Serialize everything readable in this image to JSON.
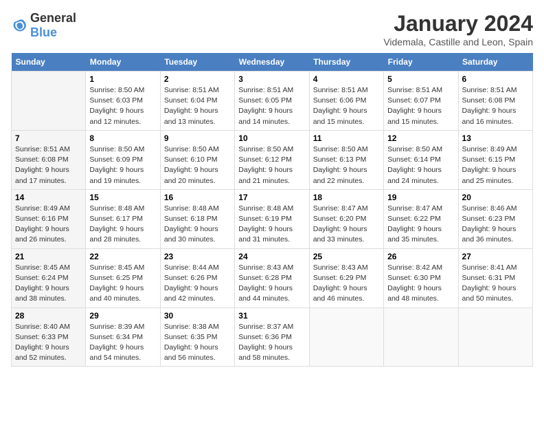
{
  "logo": {
    "general": "General",
    "blue": "Blue"
  },
  "header": {
    "month": "January 2024",
    "location": "Videmala, Castille and Leon, Spain"
  },
  "weekdays": [
    "Sunday",
    "Monday",
    "Tuesday",
    "Wednesday",
    "Thursday",
    "Friday",
    "Saturday"
  ],
  "weeks": [
    [
      {
        "day": "",
        "sunrise": "",
        "sunset": "",
        "daylight": ""
      },
      {
        "day": "1",
        "sunrise": "Sunrise: 8:50 AM",
        "sunset": "Sunset: 6:03 PM",
        "daylight": "Daylight: 9 hours and 12 minutes."
      },
      {
        "day": "2",
        "sunrise": "Sunrise: 8:51 AM",
        "sunset": "Sunset: 6:04 PM",
        "daylight": "Daylight: 9 hours and 13 minutes."
      },
      {
        "day": "3",
        "sunrise": "Sunrise: 8:51 AM",
        "sunset": "Sunset: 6:05 PM",
        "daylight": "Daylight: 9 hours and 14 minutes."
      },
      {
        "day": "4",
        "sunrise": "Sunrise: 8:51 AM",
        "sunset": "Sunset: 6:06 PM",
        "daylight": "Daylight: 9 hours and 15 minutes."
      },
      {
        "day": "5",
        "sunrise": "Sunrise: 8:51 AM",
        "sunset": "Sunset: 6:07 PM",
        "daylight": "Daylight: 9 hours and 15 minutes."
      },
      {
        "day": "6",
        "sunrise": "Sunrise: 8:51 AM",
        "sunset": "Sunset: 6:08 PM",
        "daylight": "Daylight: 9 hours and 16 minutes."
      }
    ],
    [
      {
        "day": "7",
        "sunrise": "Sunrise: 8:51 AM",
        "sunset": "Sunset: 6:08 PM",
        "daylight": "Daylight: 9 hours and 17 minutes."
      },
      {
        "day": "8",
        "sunrise": "Sunrise: 8:50 AM",
        "sunset": "Sunset: 6:09 PM",
        "daylight": "Daylight: 9 hours and 19 minutes."
      },
      {
        "day": "9",
        "sunrise": "Sunrise: 8:50 AM",
        "sunset": "Sunset: 6:10 PM",
        "daylight": "Daylight: 9 hours and 20 minutes."
      },
      {
        "day": "10",
        "sunrise": "Sunrise: 8:50 AM",
        "sunset": "Sunset: 6:12 PM",
        "daylight": "Daylight: 9 hours and 21 minutes."
      },
      {
        "day": "11",
        "sunrise": "Sunrise: 8:50 AM",
        "sunset": "Sunset: 6:13 PM",
        "daylight": "Daylight: 9 hours and 22 minutes."
      },
      {
        "day": "12",
        "sunrise": "Sunrise: 8:50 AM",
        "sunset": "Sunset: 6:14 PM",
        "daylight": "Daylight: 9 hours and 24 minutes."
      },
      {
        "day": "13",
        "sunrise": "Sunrise: 8:49 AM",
        "sunset": "Sunset: 6:15 PM",
        "daylight": "Daylight: 9 hours and 25 minutes."
      }
    ],
    [
      {
        "day": "14",
        "sunrise": "Sunrise: 8:49 AM",
        "sunset": "Sunset: 6:16 PM",
        "daylight": "Daylight: 9 hours and 26 minutes."
      },
      {
        "day": "15",
        "sunrise": "Sunrise: 8:48 AM",
        "sunset": "Sunset: 6:17 PM",
        "daylight": "Daylight: 9 hours and 28 minutes."
      },
      {
        "day": "16",
        "sunrise": "Sunrise: 8:48 AM",
        "sunset": "Sunset: 6:18 PM",
        "daylight": "Daylight: 9 hours and 30 minutes."
      },
      {
        "day": "17",
        "sunrise": "Sunrise: 8:48 AM",
        "sunset": "Sunset: 6:19 PM",
        "daylight": "Daylight: 9 hours and 31 minutes."
      },
      {
        "day": "18",
        "sunrise": "Sunrise: 8:47 AM",
        "sunset": "Sunset: 6:20 PM",
        "daylight": "Daylight: 9 hours and 33 minutes."
      },
      {
        "day": "19",
        "sunrise": "Sunrise: 8:47 AM",
        "sunset": "Sunset: 6:22 PM",
        "daylight": "Daylight: 9 hours and 35 minutes."
      },
      {
        "day": "20",
        "sunrise": "Sunrise: 8:46 AM",
        "sunset": "Sunset: 6:23 PM",
        "daylight": "Daylight: 9 hours and 36 minutes."
      }
    ],
    [
      {
        "day": "21",
        "sunrise": "Sunrise: 8:45 AM",
        "sunset": "Sunset: 6:24 PM",
        "daylight": "Daylight: 9 hours and 38 minutes."
      },
      {
        "day": "22",
        "sunrise": "Sunrise: 8:45 AM",
        "sunset": "Sunset: 6:25 PM",
        "daylight": "Daylight: 9 hours and 40 minutes."
      },
      {
        "day": "23",
        "sunrise": "Sunrise: 8:44 AM",
        "sunset": "Sunset: 6:26 PM",
        "daylight": "Daylight: 9 hours and 42 minutes."
      },
      {
        "day": "24",
        "sunrise": "Sunrise: 8:43 AM",
        "sunset": "Sunset: 6:28 PM",
        "daylight": "Daylight: 9 hours and 44 minutes."
      },
      {
        "day": "25",
        "sunrise": "Sunrise: 8:43 AM",
        "sunset": "Sunset: 6:29 PM",
        "daylight": "Daylight: 9 hours and 46 minutes."
      },
      {
        "day": "26",
        "sunrise": "Sunrise: 8:42 AM",
        "sunset": "Sunset: 6:30 PM",
        "daylight": "Daylight: 9 hours and 48 minutes."
      },
      {
        "day": "27",
        "sunrise": "Sunrise: 8:41 AM",
        "sunset": "Sunset: 6:31 PM",
        "daylight": "Daylight: 9 hours and 50 minutes."
      }
    ],
    [
      {
        "day": "28",
        "sunrise": "Sunrise: 8:40 AM",
        "sunset": "Sunset: 6:33 PM",
        "daylight": "Daylight: 9 hours and 52 minutes."
      },
      {
        "day": "29",
        "sunrise": "Sunrise: 8:39 AM",
        "sunset": "Sunset: 6:34 PM",
        "daylight": "Daylight: 9 hours and 54 minutes."
      },
      {
        "day": "30",
        "sunrise": "Sunrise: 8:38 AM",
        "sunset": "Sunset: 6:35 PM",
        "daylight": "Daylight: 9 hours and 56 minutes."
      },
      {
        "day": "31",
        "sunrise": "Sunrise: 8:37 AM",
        "sunset": "Sunset: 6:36 PM",
        "daylight": "Daylight: 9 hours and 58 minutes."
      },
      {
        "day": "",
        "sunrise": "",
        "sunset": "",
        "daylight": ""
      },
      {
        "day": "",
        "sunrise": "",
        "sunset": "",
        "daylight": ""
      },
      {
        "day": "",
        "sunrise": "",
        "sunset": "",
        "daylight": ""
      }
    ]
  ]
}
